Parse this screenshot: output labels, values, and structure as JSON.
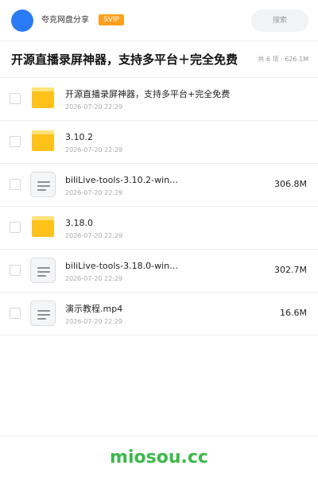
{
  "header": {
    "owner_name": "夸克网盘分享",
    "badge": "SVIP",
    "search_placeholder": "搜索",
    "avatar_color": "#2a7bf6",
    "badge_color": "#ff9f1c"
  },
  "share": {
    "title": "开源直播录屏神器，支持多平台＋完全免费",
    "summary": "共 6 项 · 626.1M"
  },
  "files": [
    {
      "type": "folder",
      "icon": "folder-icon",
      "name": "开源直播录屏神器，支持多平台+完全免费",
      "date": "2026-07-20 22:29",
      "size": ""
    },
    {
      "type": "folder",
      "icon": "folder-icon",
      "name": "3.10.2",
      "date": "2026-07-20 22:29",
      "size": ""
    },
    {
      "type": "file",
      "icon": "file-icon",
      "name": "biliLive-tools-3.10.2-win…",
      "date": "2026-07-20 22:29",
      "size": "306.8M"
    },
    {
      "type": "folder",
      "icon": "folder-icon",
      "name": "3.18.0",
      "date": "2026-07-20 22:29",
      "size": ""
    },
    {
      "type": "file",
      "icon": "file-icon",
      "name": "biliLive-tools-3.18.0-win…",
      "date": "2026-07-20 22:29",
      "size": "302.7M"
    },
    {
      "type": "file",
      "icon": "file-icon",
      "name": "演示教程.mp4",
      "date": "2026-07-20 22:29",
      "size": "16.6M"
    }
  ],
  "footer": {
    "brand": "miosou.cc",
    "brand_color": "#3cb84a"
  }
}
